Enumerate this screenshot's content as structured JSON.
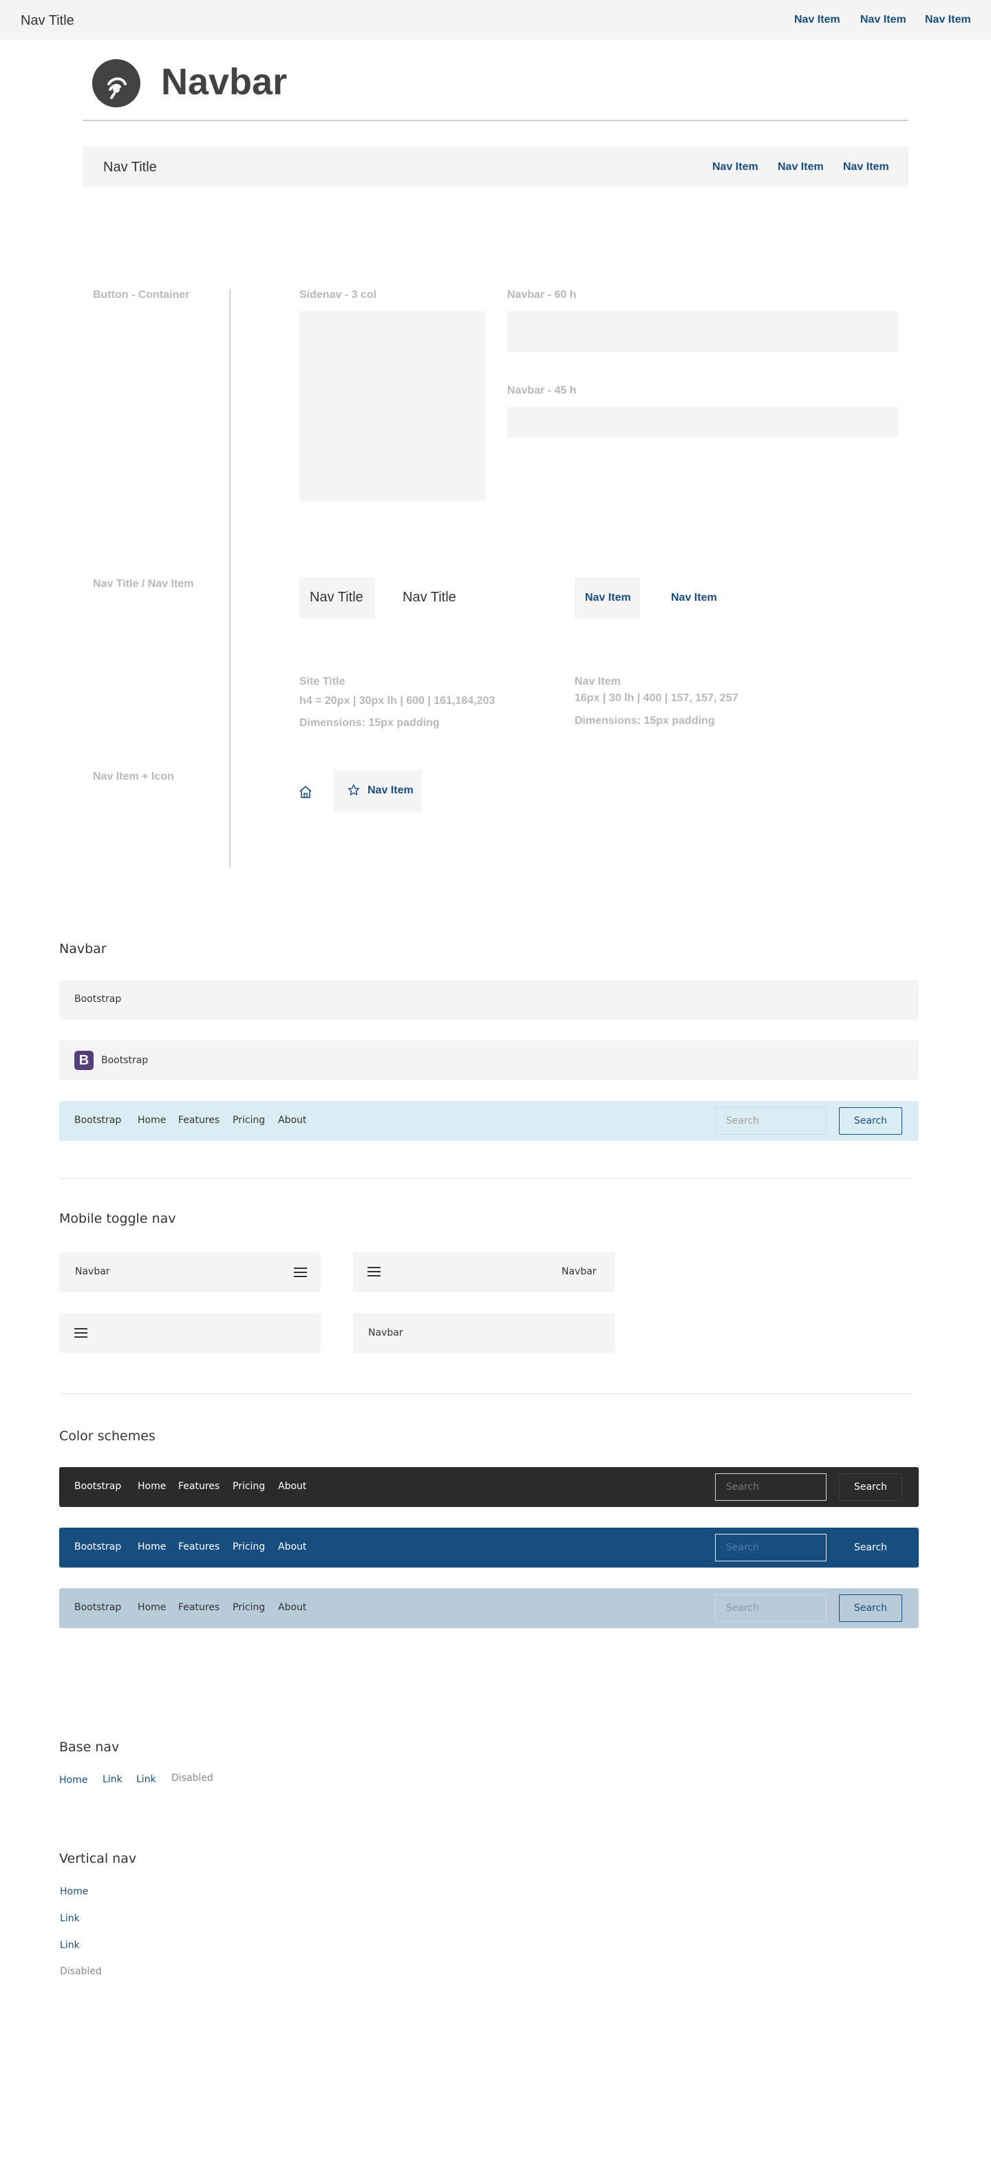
{
  "topbar": {
    "title": "Nav Title",
    "items": [
      "Nav Item",
      "Nav Item",
      "Nav Item"
    ]
  },
  "hero": {
    "title": "Navbar"
  },
  "demo_bar": {
    "title": "Nav Title",
    "items": [
      "Nav Item",
      "Nav Item",
      "Nav Item"
    ]
  },
  "spec": {
    "button_container": "Button - Container",
    "sidenav": "Sidenav - 3 col",
    "navbar60": "Navbar - 60 h",
    "navbar45": "Navbar - 45 h",
    "nav_title_item": "Nav Title / Nav Item",
    "nav_title_a": "Nav Title",
    "nav_title_b": "Nav Title",
    "nav_item_a": "Nav Item",
    "nav_item_b": "Nav Item",
    "site_title": "Site Title",
    "site_title_spec": "h4 = 20px | 30px lh | 600 | 161,184,203",
    "site_title_dims": "Dimensions: 15px padding",
    "nav_item_label": "Nav Item",
    "nav_item_spec": "16px | 30 lh | 400 | 157, 157, 257",
    "nav_item_dims": "Dimensions: 15px padding",
    "nav_item_icon": "Nav Item + Icon",
    "icon_nav_item": "Nav Item"
  },
  "navbar_section": {
    "title": "Navbar",
    "bar1_brand": "Bootstrap",
    "bar2_brand": "Bootstrap",
    "bar2_logo": "B",
    "bar3": {
      "brand": "Bootstrap",
      "links": [
        "Home",
        "Features",
        "Pricing",
        "About"
      ],
      "search_placeholder": "Search",
      "search_button": "Search"
    }
  },
  "mobile_section": {
    "title": "Mobile toggle nav",
    "a_label": "Navbar",
    "b_label": "Navbar",
    "d_label": "Navbar"
  },
  "color_section": {
    "title": "Color schemes",
    "dark": {
      "brand": "Bootstrap",
      "links": [
        "Home",
        "Features",
        "Pricing",
        "About"
      ],
      "search_placeholder": "Search",
      "search_button": "Search"
    },
    "primary": {
      "brand": "Bootstrap",
      "links": [
        "Home",
        "Features",
        "Pricing",
        "About"
      ],
      "search_placeholder": "Search",
      "search_button": "Search"
    },
    "light": {
      "brand": "Bootstrap",
      "links": [
        "Home",
        "Features",
        "Pricing",
        "About"
      ],
      "search_placeholder": "Search",
      "search_button": "Search"
    }
  },
  "base_nav": {
    "title": "Base nav",
    "items": [
      "Home",
      "Link",
      "Link"
    ],
    "disabled": "Disabled"
  },
  "vertical_nav": {
    "title": "Vertical nav",
    "items": [
      "Home",
      "Link",
      "Link"
    ],
    "disabled": "Disabled"
  },
  "colors": {
    "link": "#184d80",
    "muted": "#b8b8b8",
    "light_bg": "#f4f4f4",
    "info_bg": "#daedf2",
    "dark_bg": "#2b2b2b",
    "primary_bg": "#184d80",
    "slate_bg": "#b8cbd9",
    "bootstrap_purple": "#563d7c"
  }
}
